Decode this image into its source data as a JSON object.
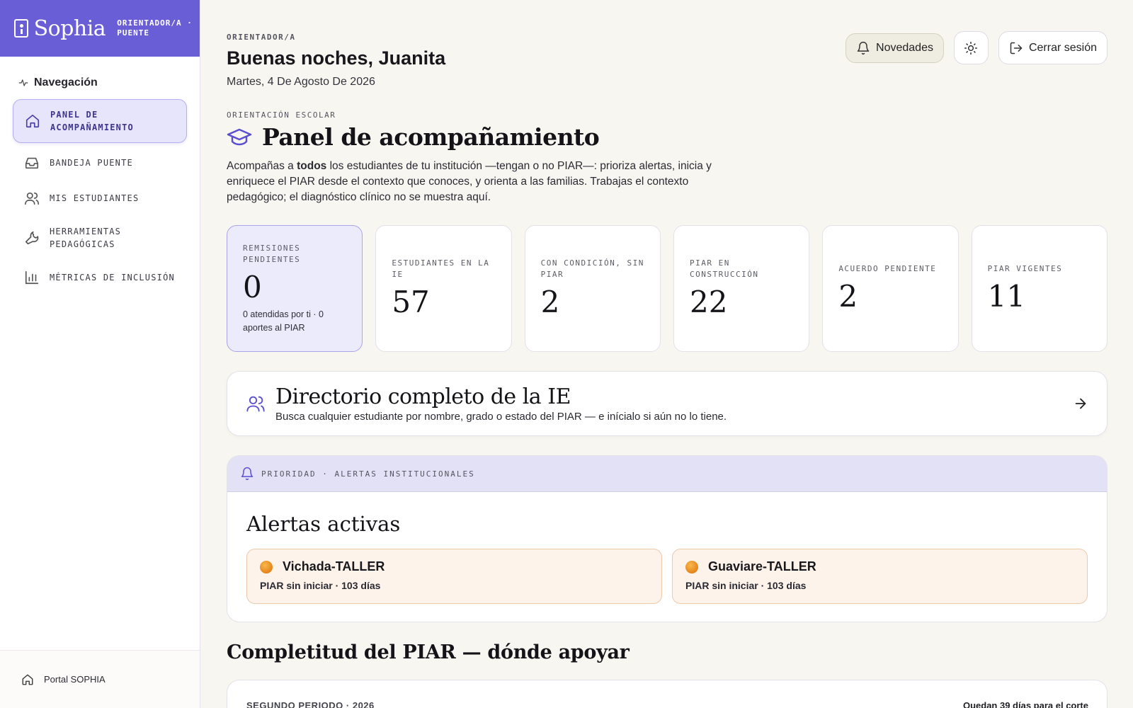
{
  "brand": {
    "name": "Sophia",
    "role": "ORIENTADOR/A · PUENTE"
  },
  "nav": {
    "heading": "Navegación",
    "items": [
      {
        "label": "PANEL DE ACOMPAÑAMIENTO",
        "icon": "home-icon",
        "active": true
      },
      {
        "label": "BANDEJA PUENTE",
        "icon": "inbox-icon"
      },
      {
        "label": "MIS ESTUDIANTES",
        "icon": "users-icon"
      },
      {
        "label": "HERRAMIENTAS PEDAGÓGICAS",
        "icon": "wrench-icon"
      },
      {
        "label": "MÉTRICAS DE INCLUSIÓN",
        "icon": "bar-chart-icon"
      }
    ],
    "footer": "Portal SOPHIA"
  },
  "header": {
    "role": "ORIENTADOR/A",
    "greeting": "Buenas noches, Juanita",
    "date": "Martes, 4 De Agosto De 2026",
    "news_label": "Novedades",
    "logout_label": "Cerrar sesión"
  },
  "panel": {
    "eyebrow": "ORIENTACIÓN ESCOLAR",
    "title": "Panel de acompañamiento",
    "intro_prefix": "Acompañas a ",
    "intro_bold": "todos",
    "intro_suffix": " los estudiantes de tu institución —tengan o no PIAR—: prioriza alertas, inicia y enriquece el PIAR desde el contexto que conoces, y orienta a las familias. Trabajas el contexto pedagógico; el diagnóstico clínico no se muestra aquí."
  },
  "stats": [
    {
      "label": "REMISIONES PENDIENTES",
      "value": "0",
      "sub": "0 atendidas por ti · 0 aportes al PIAR"
    },
    {
      "label": "ESTUDIANTES EN LA IE",
      "value": "57"
    },
    {
      "label": "CON CONDICIÓN, SIN PIAR",
      "value": "2"
    },
    {
      "label": "PIAR EN CONSTRUCCIÓN",
      "value": "22"
    },
    {
      "label": "ACUERDO PENDIENTE",
      "value": "2"
    },
    {
      "label": "PIAR VIGENTES",
      "value": "11"
    }
  ],
  "directory": {
    "title": "Directorio completo de la IE",
    "subtitle": "Busca cualquier estudiante por nombre, grado o estado del PIAR — e inícialo si aún no lo tiene."
  },
  "alerts": {
    "eyebrow": "PRIORIDAD · ALERTAS INSTITUCIONALES",
    "title": "Alertas activas",
    "items": [
      {
        "name": "Vichada-TALLER",
        "meta": "PIAR sin iniciar · 103 días",
        "color": "#e8891c"
      },
      {
        "name": "Guaviare-TALLER",
        "meta": "PIAR sin iniciar · 103 días",
        "color": "#e8891c"
      }
    ]
  },
  "completitud": {
    "title": "Completitud del PIAR — dónde apoyar",
    "period": "SEGUNDO PERIODO · 2026",
    "days_left": "Quedan 39 días para el corte"
  },
  "colors": {
    "accent": "#6a5ed6",
    "alert_bg": "#fdf3ea",
    "alert_border": "#ecc9a9"
  }
}
